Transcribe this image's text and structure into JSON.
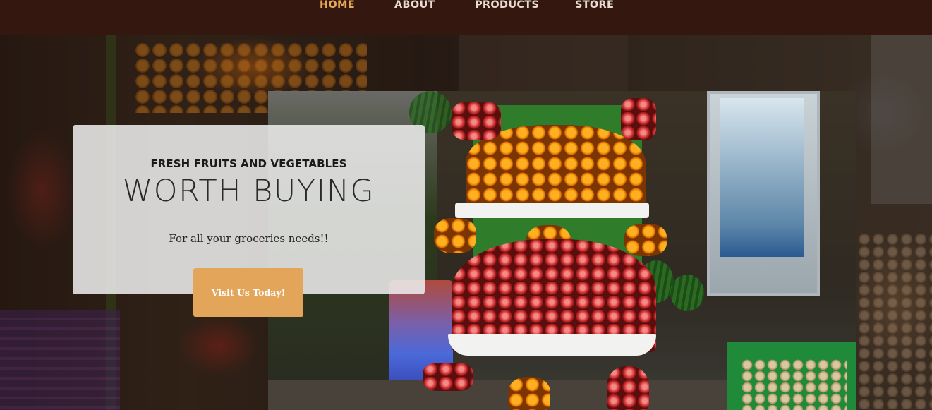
{
  "nav": {
    "items": [
      {
        "label": "HOME",
        "active": true
      },
      {
        "label": "ABOUT",
        "active": false
      },
      {
        "label": "PRODUCTS",
        "active": false
      },
      {
        "label": "STORE",
        "active": false
      }
    ]
  },
  "hero": {
    "kicker": "FRESH FRUITS AND VEGETABLES",
    "headline": "WORTH BUYING",
    "subtitle": "For all your groceries needs!!",
    "cta_label": "Visit Us Today!"
  },
  "colors": {
    "nav_background": "#341810",
    "nav_active": "#e8a857",
    "nav_text": "#e8dcd2",
    "cta_background": "#e3a55a",
    "card_background": "#ececec"
  }
}
